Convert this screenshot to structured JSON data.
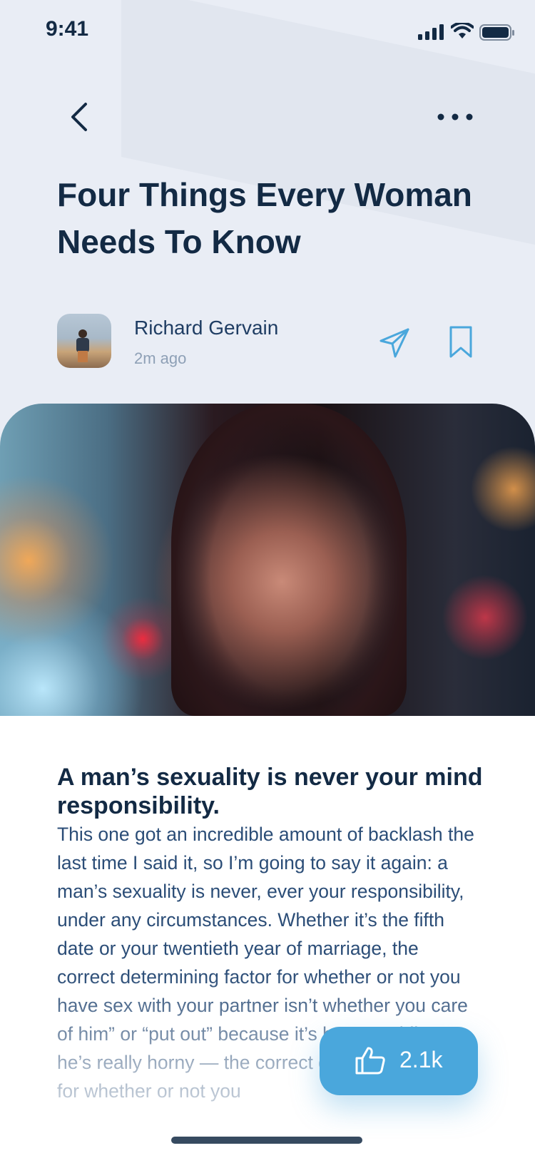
{
  "status_bar": {
    "time": "9:41"
  },
  "article": {
    "title": "Four Things Every Woman Needs To Know",
    "author": {
      "name": "Richard Gervain",
      "posted": "2m ago"
    },
    "subheading": "A man’s sexuality is never your mind responsibility.",
    "body": "This one got an incredible amount of backlash the last time I said it, so I’m going to say it again: a man’s sexuality is never, ever your responsibility, under any circumstances. Whether it’s the fifth date or your twentieth year of marriage, the correct determining factor for whether or not you have sex with your partner isn’t whether you care of him” or “put out” because it’s been a while or he’s really horny — the correct determining factor for whether or not you"
  },
  "like_button": {
    "count": "2.1k"
  },
  "icons": [
    "back-chevron-icon",
    "more-dots-icon",
    "send-icon",
    "bookmark-icon",
    "thumbs-up-icon",
    "signal-icon",
    "wifi-icon",
    "battery-icon"
  ],
  "colors": {
    "accent": "#4aa7dc",
    "title": "#132a44",
    "body": "#2b4d77",
    "meta": "#8ea0b6"
  }
}
